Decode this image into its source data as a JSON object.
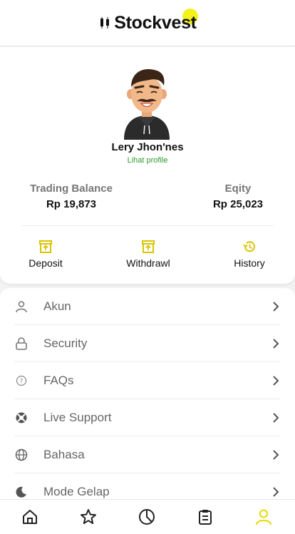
{
  "app": {
    "brand": "Stockvest"
  },
  "profile": {
    "name": "Lery Jhon'nes",
    "profile_link": "Lihat profile",
    "trading_balance_label": "Trading Balance",
    "trading_balance_value": "Rp 19,873",
    "equity_label": "Eqity",
    "equity_value": "Rp 25,023"
  },
  "actions": [
    {
      "label": "Deposit",
      "icon": "deposit-box-icon"
    },
    {
      "label": "Withdrawl",
      "icon": "withdraw-box-icon"
    },
    {
      "label": "History",
      "icon": "history-icon"
    }
  ],
  "menu": [
    {
      "label": "Akun",
      "icon": "user-icon"
    },
    {
      "label": "Security",
      "icon": "lock-icon"
    },
    {
      "label": "FAQs",
      "icon": "question-icon"
    },
    {
      "label": "Live Support",
      "icon": "lifebuoy-icon"
    },
    {
      "label": "Bahasa",
      "icon": "globe-icon"
    },
    {
      "label": "Mode Gelap",
      "icon": "moon-icon"
    }
  ],
  "bottom_nav": [
    {
      "name": "home",
      "icon": "home-icon",
      "active": false
    },
    {
      "name": "favorites",
      "icon": "star-icon",
      "active": false
    },
    {
      "name": "portfolio",
      "icon": "pie-chart-icon",
      "active": false
    },
    {
      "name": "orders",
      "icon": "clipboard-icon",
      "active": false
    },
    {
      "name": "profile",
      "icon": "user-icon",
      "active": true
    }
  ],
  "colors": {
    "accent": "#f4f21b",
    "link_green": "#2e9a2e",
    "text_dark": "#111111",
    "text_muted": "#666666"
  }
}
